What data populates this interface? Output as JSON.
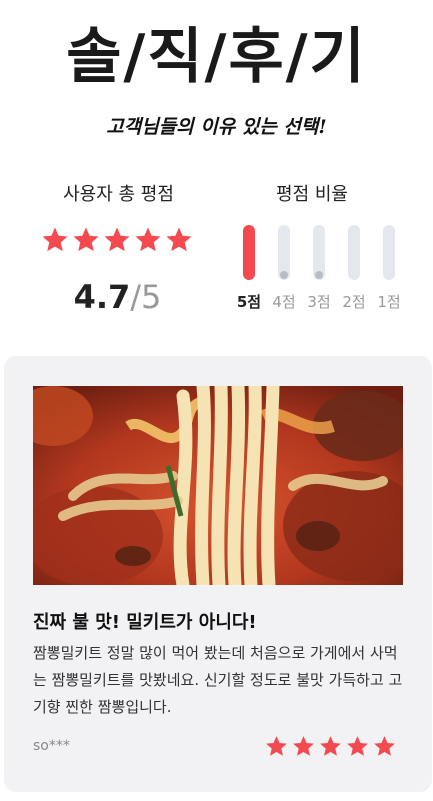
{
  "header": {
    "title": "솔/직/후/기",
    "subtitle": "고객님들의 이유 있는 선택!"
  },
  "summary": {
    "user_rating_label": "사용자 총 평점",
    "ratio_label": "평점 비율",
    "score": "4.7",
    "slash": "/",
    "max": "5",
    "stars": 5,
    "star_color": "#f44a4f"
  },
  "ratio": {
    "items": [
      {
        "label": "5점",
        "fraction": 1.0,
        "active": true
      },
      {
        "label": "4점",
        "fraction": 0.0,
        "active": false
      },
      {
        "label": "3점",
        "fraction": 0.0,
        "active": false
      },
      {
        "label": "2점",
        "fraction": 0.0,
        "active": false
      },
      {
        "label": "1점",
        "fraction": 0.0,
        "active": false
      }
    ],
    "fill_color": "#f44a4f"
  },
  "review": {
    "image_alt": "짬뽕 면 사진",
    "title": "진짜 불 맛! 밀키트가 아니다!",
    "body": "짬뽕밀키트 정말 많이 먹어 봤는데 처음으로 가게에서 사먹는 짬뽕밀키트를 맛봤네요. 신기할 정도로 불맛 가득하고 고기향 찐한 짬뽕입니다.",
    "reviewer": "so***",
    "stars": 5
  }
}
